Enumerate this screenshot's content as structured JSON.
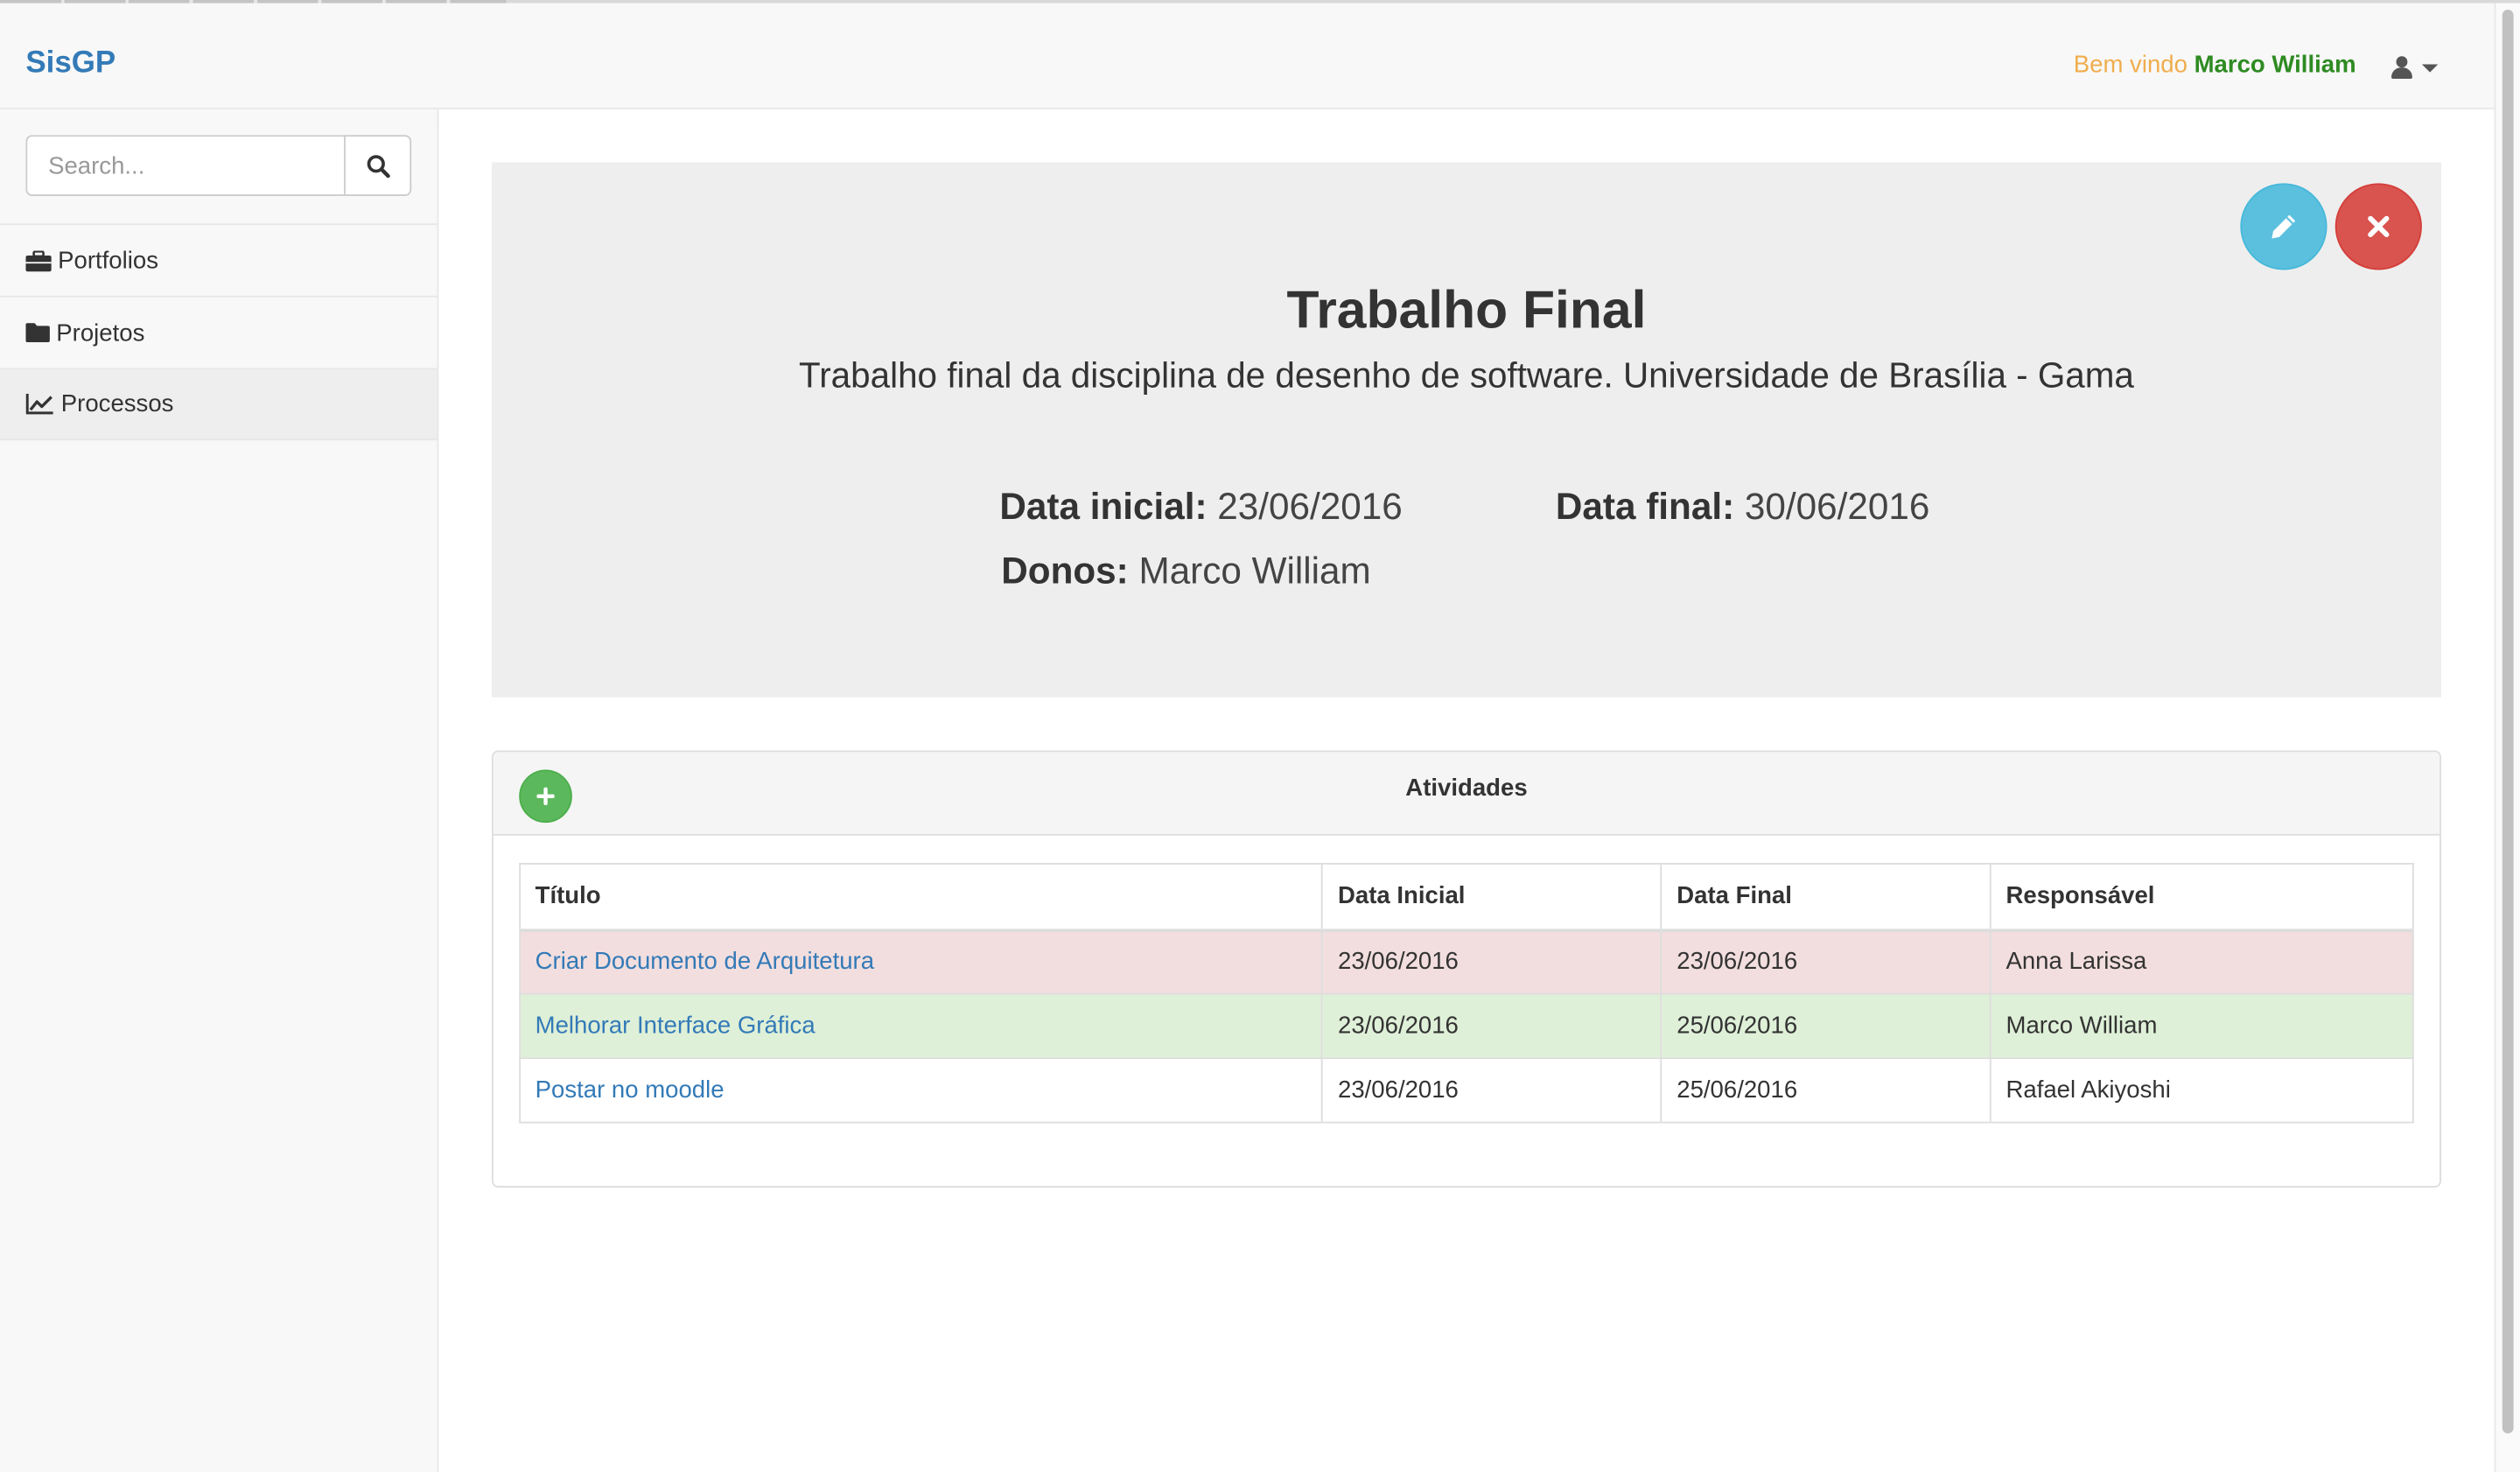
{
  "navbar": {
    "brand": "SisGP",
    "welcome_prefix": "Bem vindo",
    "user_name": "Marco William",
    "user_icon": "user-icon",
    "caret_icon": "caret-down-icon"
  },
  "sidebar": {
    "search": {
      "placeholder": "Search...",
      "value": "",
      "button_icon": "search-icon"
    },
    "items": [
      {
        "label": "Portfolios",
        "icon": "briefcase-icon",
        "active": false
      },
      {
        "label": "Projetos",
        "icon": "folder-icon",
        "active": false
      },
      {
        "label": "Processos",
        "icon": "line-chart-icon",
        "active": true
      }
    ]
  },
  "project": {
    "title": "Trabalho Final",
    "description": "Trabalho final da disciplina de desenho de software. Universidade de Brasília - Gama",
    "start_label": "Data inicial:",
    "start_value": "23/06/2016",
    "end_label": "Data final:",
    "end_value": "30/06/2016",
    "owners_label": "Donos:",
    "owners_value": "Marco William",
    "edit_icon": "pencil-icon",
    "delete_icon": "close-icon"
  },
  "activities": {
    "title": "Atividades",
    "add_icon": "plus-icon",
    "columns": [
      "Título",
      "Data Inicial",
      "Data Final",
      "Responsável"
    ],
    "rows": [
      {
        "title": "Criar Documento de Arquitetura",
        "start": "23/06/2016",
        "end": "23/06/2016",
        "owner": "Anna Larissa",
        "status": "danger"
      },
      {
        "title": "Melhorar Interface Gráfica",
        "start": "23/06/2016",
        "end": "25/06/2016",
        "owner": "Marco William",
        "status": "success"
      },
      {
        "title": "Postar no moodle",
        "start": "23/06/2016",
        "end": "25/06/2016",
        "owner": "Rafael Akiyoshi",
        "status": "default"
      }
    ]
  },
  "colors": {
    "brand": "#337ab7",
    "welcome_prefix": "#f0ad4e",
    "user_name": "#2e8b22",
    "info_button": "#5bc0de",
    "danger_button": "#d9534f",
    "success_button": "#5cb85c",
    "row_danger": "#f2dede",
    "row_success": "#dff0d8"
  }
}
